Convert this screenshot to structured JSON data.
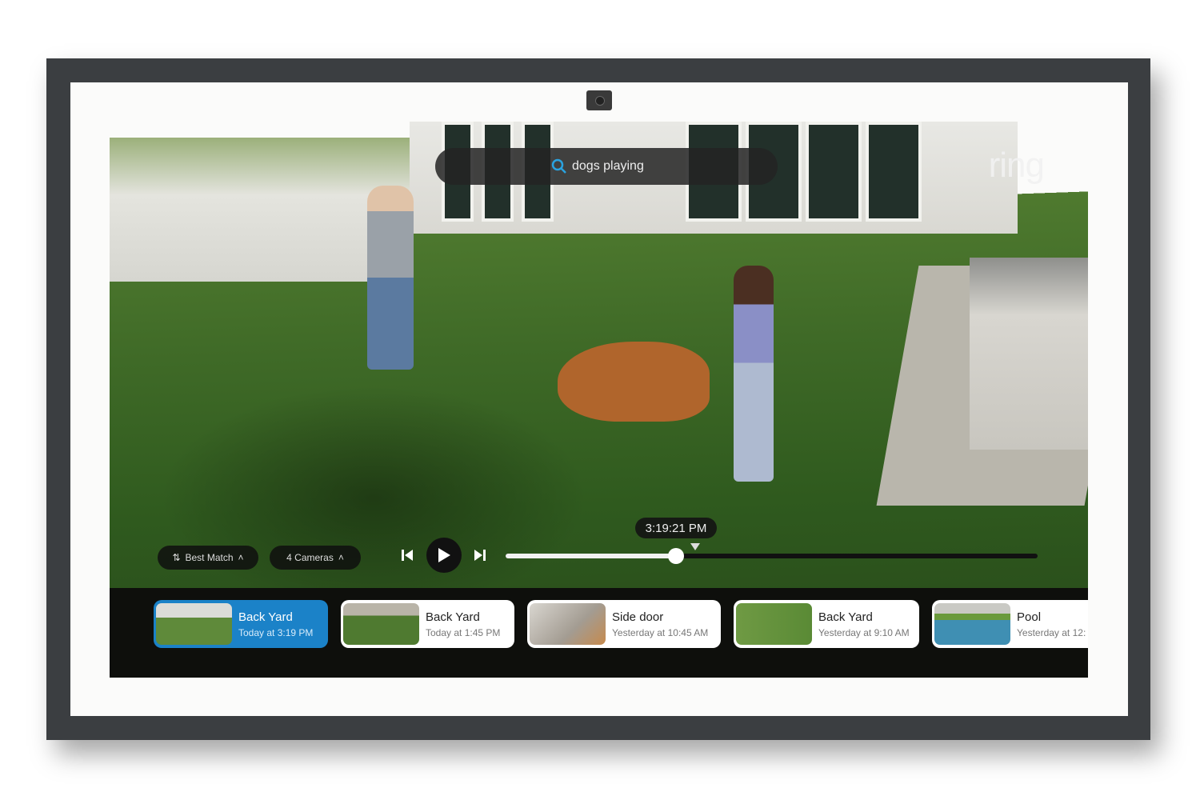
{
  "brand": {
    "logo": "ring"
  },
  "search": {
    "query": "dogs playing",
    "icon": "search-icon",
    "accent": "#2aa3e0"
  },
  "controls": {
    "sort": {
      "label": "Best Match",
      "icon": "sort-icon"
    },
    "cameras": {
      "label": "4 Cameras"
    },
    "timeline": {
      "current_time": "3:19:21 PM",
      "progress_percent": 32
    }
  },
  "events": [
    {
      "camera": "Back Yard",
      "time": "Today at 3:19 PM",
      "selected": true
    },
    {
      "camera": "Back Yard",
      "time": "Today at 1:45 PM",
      "selected": false
    },
    {
      "camera": "Side door",
      "time": "Yesterday at 10:45 AM",
      "selected": false
    },
    {
      "camera": "Back Yard",
      "time": "Yesterday at 9:10 AM",
      "selected": false
    },
    {
      "camera": "Pool",
      "time": "Yesterday at 12:",
      "selected": false
    }
  ],
  "colors": {
    "selected_card": "#1b82c8",
    "bezel": "#3b3e41"
  }
}
